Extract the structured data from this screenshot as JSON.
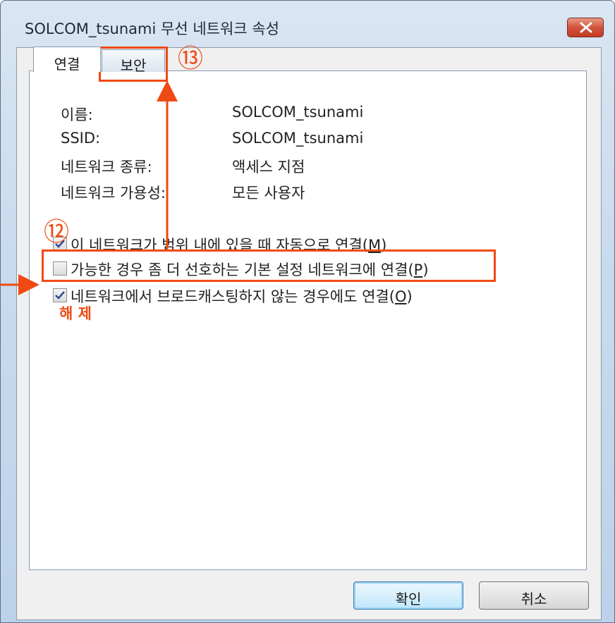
{
  "window": {
    "title": "SOLCOM_tsunami 무선 네트워크 속성",
    "close_icon": "close-icon"
  },
  "tabs": [
    {
      "label": "연결",
      "selected": true
    },
    {
      "label": "보안",
      "selected": false
    }
  ],
  "properties": [
    {
      "label": "이름:",
      "value": "SOLCOM_tsunami"
    },
    {
      "label": "SSID:",
      "value": "SOLCOM_tsunami"
    },
    {
      "label": "네트워크 종류:",
      "value": "액세스 지점"
    },
    {
      "label": "네트워크 가용성:",
      "value": "모든 사용자"
    }
  ],
  "options": [
    {
      "text": "이 네트워크가 범위 내에 있을 때 자동으로 연결(",
      "key": "M",
      "end": ")",
      "checked": true
    },
    {
      "text": "가능한 경우 좀 더 선호하는 기본 설정 네트워크에 연결(",
      "key": "P",
      "end": ")",
      "checked": false
    },
    {
      "text": "네트워크에서 브로드캐스팅하지 않는 경우에도 연결(",
      "key": "O",
      "end": ")",
      "checked": true
    }
  ],
  "buttons": {
    "ok": "확인",
    "cancel": "취소"
  },
  "annotations": {
    "step_12": "⑫",
    "step_13": "⑬",
    "note": "해 제",
    "color": "#f04a14"
  }
}
